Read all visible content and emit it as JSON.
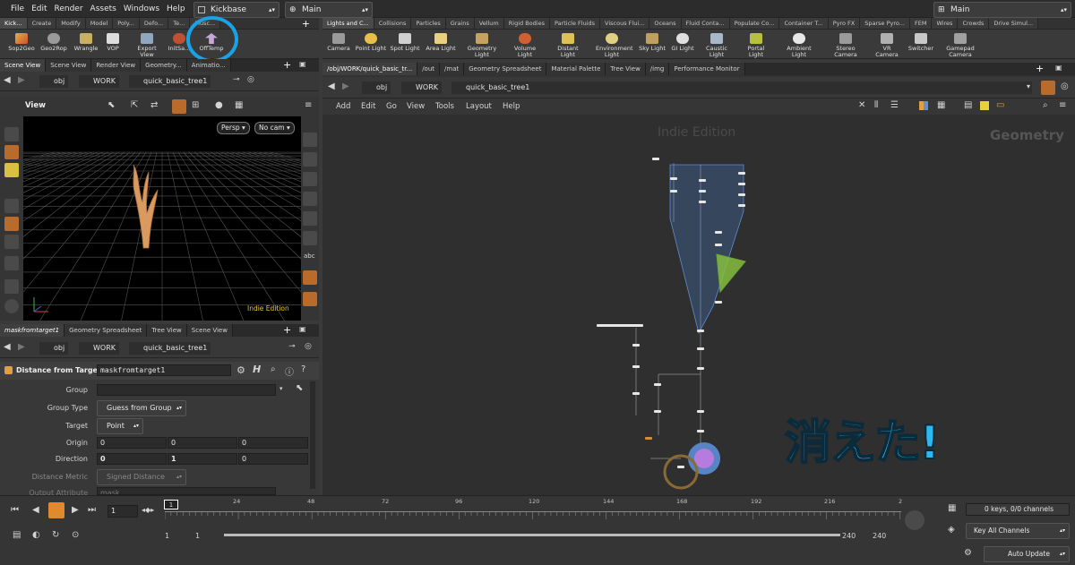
{
  "menu": [
    "File",
    "Edit",
    "Render",
    "Assets",
    "Windows",
    "Help"
  ],
  "desktop": "Kickbase",
  "context_left": "Main",
  "context_right": "Main",
  "shelf_left_tabs": [
    "Kick...",
    "Create",
    "Modify",
    "Model",
    "Poly...",
    "Defo...",
    "Te...",
    "Musc..."
  ],
  "shelf_left_tools": [
    "Sop2Geo",
    "Geo2Rop",
    "Wrangle",
    "VOP",
    "Export View",
    "InitSa...",
    "OffTemp"
  ],
  "shelf_right_tabs": [
    "Lights and C...",
    "Collisions",
    "Particles",
    "Grains",
    "Vellum",
    "Rigid Bodies",
    "Particle Fluids",
    "Viscous Flui...",
    "Oceans",
    "Fluid Conta...",
    "Populate Co...",
    "Container T...",
    "Pyro FX",
    "Sparse Pyro...",
    "FEM",
    "Wires",
    "Crowds",
    "Drive Simul..."
  ],
  "shelf_right_tools": [
    "Camera",
    "Point Light",
    "Spot Light",
    "Area Light",
    "Geometry Light",
    "Volume Light",
    "Distant Light",
    "Environment Light",
    "Sky Light",
    "GI Light",
    "Caustic Light",
    "Portal Light",
    "Ambient Light",
    "Stereo Camera",
    "VR Camera",
    "Switcher",
    "Gamepad Camera"
  ],
  "left_top_tabs": [
    "Scene View",
    "Scene View",
    "Render View",
    "Geometry...",
    "Animatio..."
  ],
  "path": {
    "obj": "obj",
    "work": "WORK",
    "node": "quick_basic_tree1"
  },
  "viewport": {
    "title": "View",
    "persp": "Persp",
    "cam": "No cam",
    "edition": "Indie Edition",
    "text_tool": "abc"
  },
  "right_tabs": [
    "/obj/WORK/quick_basic_tr...",
    "/out",
    "/mat",
    "Geometry Spreadsheet",
    "Material Palette",
    "Tree View",
    "/img",
    "Performance Monitor"
  ],
  "network_menu": [
    "Add",
    "Edit",
    "Go",
    "View",
    "Tools",
    "Layout",
    "Help"
  ],
  "network": {
    "watermark": "Indie Edition",
    "context": "Geometry",
    "overlay": "消えた!"
  },
  "param_tabs": [
    "maskfromtarget1",
    "Geometry Spreadsheet",
    "Tree View",
    "Scene View"
  ],
  "param": {
    "node_type": "Distance from Target",
    "node_name": "maskfromtarget1",
    "group_label": "Group",
    "group_value": "",
    "group_type_label": "Group Type",
    "group_type_value": "Guess from Group",
    "target_label": "Target",
    "target_value": "Point",
    "origin_label": "Origin",
    "origin": [
      "0",
      "0",
      "0"
    ],
    "direction_label": "Direction",
    "direction": [
      "0",
      "1",
      "0"
    ],
    "metric_label": "Distance Metric",
    "metric_value": "Signed Distance",
    "output_label": "Output Attribute",
    "output_value": "mask"
  },
  "timeline": {
    "ticks": [
      "24",
      "48",
      "72",
      "96",
      "120",
      "144",
      "168",
      "192",
      "216",
      "2"
    ],
    "frame": "1",
    "frame_marker": "1",
    "start": "1",
    "start2": "1",
    "end": "240",
    "end2": "240"
  },
  "status": {
    "keys": "0 keys, 0/0 channels",
    "key_all": "Key All Channels",
    "auto_update": "Auto Update"
  },
  "colors": {
    "accent": "#e08a2e",
    "highlight_circle": "#19a3e6",
    "overlay_text": "#2db8ef",
    "network_box": "#5b8ed6",
    "green_node": "#8bc53f",
    "purple_node": "#b77be0"
  }
}
